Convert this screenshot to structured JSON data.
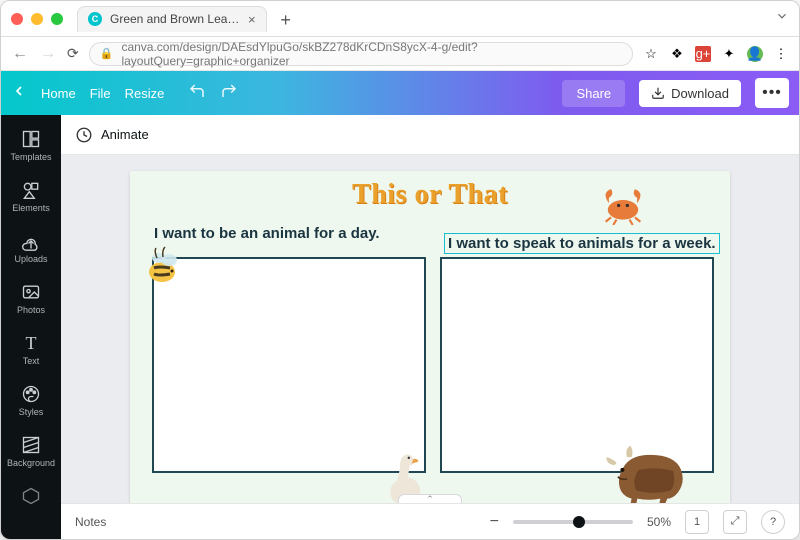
{
  "browser": {
    "tab_title": "Green and Brown Leaves Fores…",
    "url": "canva.com/design/DAEsdYlpuGo/skBZ278dKrCDnS8ycX-4-g/edit?layoutQuery=graphic+organizer"
  },
  "appbar": {
    "home": "Home",
    "file": "File",
    "resize": "Resize",
    "share": "Share",
    "download": "Download"
  },
  "sidebar": {
    "items": [
      {
        "label": "Templates"
      },
      {
        "label": "Elements"
      },
      {
        "label": "Uploads"
      },
      {
        "label": "Photos"
      },
      {
        "label": "Text"
      },
      {
        "label": "Styles"
      },
      {
        "label": "Background"
      }
    ]
  },
  "toolbar": {
    "animate": "Animate"
  },
  "canvas": {
    "title": "This or That",
    "prompt_left": "I want to be an animal for a day.",
    "prompt_right": "I want to speak to animals for a week."
  },
  "bottom": {
    "notes": "Notes",
    "zoom": "50%",
    "pages": "1"
  }
}
